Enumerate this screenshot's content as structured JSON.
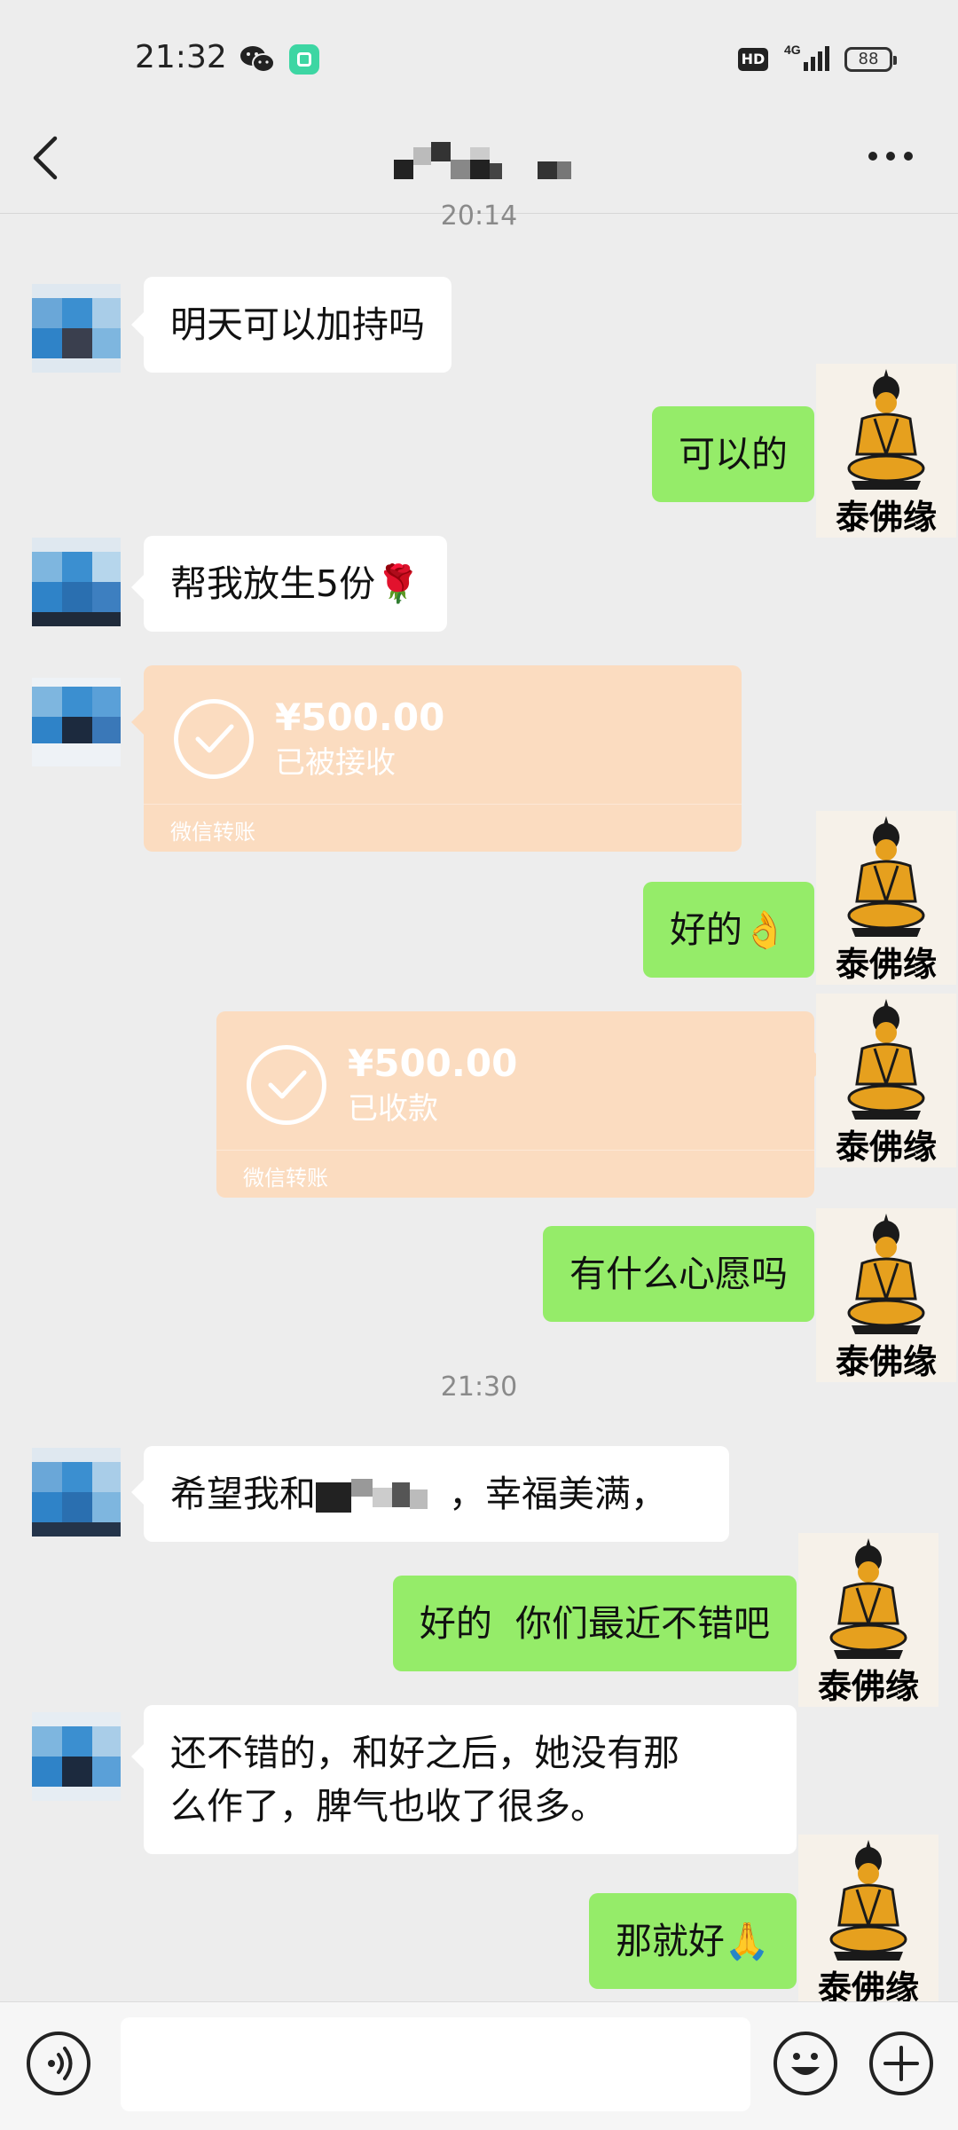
{
  "status_bar": {
    "time": "21:32",
    "network": "4G",
    "hd": "HD",
    "battery": "88"
  },
  "header": {
    "back_icon": "chevron-left-icon",
    "more_icon": "more-dots-icon"
  },
  "colors": {
    "background": "#ededed",
    "my_bubble": "#95ec69",
    "their_bubble": "#ffffff",
    "transfer_card": "#fbdcc0"
  },
  "brand_avatar_caption": "泰佛缘",
  "messages": {
    "time_1": "20:14",
    "m1": "明天可以加持吗",
    "m2": "可以的",
    "m3": "帮我放生5份🌹",
    "t1_amount": "¥500.00",
    "t1_status": "已被接收",
    "t1_label": "微信转账",
    "m4": "好的👌",
    "t2_amount": "¥500.00",
    "t2_status": "已收款",
    "t2_label": "微信转账",
    "m5": "有什么心愿吗",
    "time_2": "21:30",
    "m6_a": "希望我和",
    "m6_b": "，幸福美满，",
    "m7": "好的  你们最近不错吧",
    "m8_line1": "还不错的，和好之后，她没有那",
    "m8_line2": "么作了，脾气也收了很多。",
    "m9": "那就好🙏"
  },
  "input_bar": {
    "voice_icon": "voice-icon",
    "emoji_icon": "emoji-icon",
    "plus_icon": "plus-icon"
  }
}
